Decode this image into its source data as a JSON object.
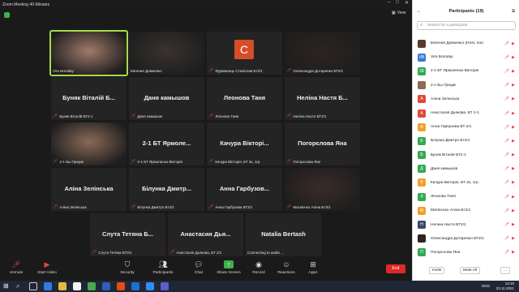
{
  "window": {
    "title": "Zoom Meeting 40-Minutes",
    "view_label": "View"
  },
  "tiles": [
    {
      "name": "",
      "label": "Vira Boroday",
      "muted": false,
      "kind": "photo",
      "photo_color": "#a07a6a",
      "active": true
    },
    {
      "name": "",
      "label": "Евгения Довженко",
      "muted": false,
      "kind": "photo",
      "photo_color": "#3a3230"
    },
    {
      "name": "",
      "label": "Фурманець Станіслав Бт2/1",
      "muted": true,
      "kind": "letter",
      "letter": "C"
    },
    {
      "name": "",
      "label": "Олександра Дотаренко БТ2/1",
      "muted": true,
      "kind": "photo",
      "photo_color": "#2c2420"
    },
    {
      "name": "Буняк Віталій Б...",
      "label": "Буняк Віталій БТ2-1",
      "muted": true,
      "kind": "text"
    },
    {
      "name": "Даня камышов",
      "label": "Даня камышов",
      "muted": true,
      "kind": "text"
    },
    {
      "name": "Леонова Таня",
      "label": "Леонова Таня",
      "muted": true,
      "kind": "text"
    },
    {
      "name": "Неліна Настя Б...",
      "label": "Неліна Настя БТ2/1",
      "muted": true,
      "kind": "text"
    },
    {
      "name": "",
      "label": "2-1 Бы Грицик",
      "muted": true,
      "kind": "photo",
      "photo_color": "#8a6a58"
    },
    {
      "name": "2-1 БТ Ярмоле...",
      "label": "2-1 БТ Ярмоленко Вікторія",
      "muted": true,
      "kind": "text"
    },
    {
      "name": "Качура Вікторі...",
      "label": "Качура Вікторія, БТ 2к, 1гр",
      "muted": true,
      "kind": "text"
    },
    {
      "name": "Погорєлова Яна",
      "label": "Погорєлова Яна",
      "muted": true,
      "kind": "text"
    },
    {
      "name": "Аліна Зелінська",
      "label": "Аліна Зелінська",
      "muted": true,
      "kind": "text"
    },
    {
      "name": "Білунка Дмитр...",
      "label": "Білунка Дмитро Бт2/1",
      "muted": true,
      "kind": "text"
    },
    {
      "name": "Анна Гарбузов...",
      "label": "Анна Гарбузова БТ2/1",
      "muted": true,
      "kind": "text"
    },
    {
      "name": "",
      "label": "Матвієнко Аліна Бт2/1",
      "muted": true,
      "kind": "photo",
      "photo_color": "#3a2c28"
    },
    {
      "name": "Слута Тетяна Б...",
      "label": "Слута Тетяна БТ2/1",
      "muted": true,
      "kind": "text"
    },
    {
      "name": "Анастасия Дья...",
      "label": "Анастасия Дьякова, БТ 2/1",
      "muted": true,
      "kind": "text"
    },
    {
      "name": "Natalia Bertash",
      "label": "Connecting to audio ...",
      "muted": false,
      "kind": "text"
    }
  ],
  "toolbar": {
    "unmute": "Unmute",
    "start_video": "Start Video",
    "security": "Security",
    "participants": "Participants",
    "participants_count": "19",
    "chat": "Chat",
    "share_screen": "Share Screen",
    "record": "Record",
    "reactions": "Reactions",
    "apps": "Apps",
    "end": "End"
  },
  "panel": {
    "title": "Participants (19)",
    "search_placeholder": "Search for a participant",
    "invite": "Invite",
    "mute_all": "Mute All",
    "more": "...",
    "participants": [
      {
        "name": "Евгения Довженко (Host, me)",
        "avatar": "",
        "color": "#5a3a30"
      },
      {
        "name": "Vira Boroday",
        "avatar": "VB",
        "color": "#3a7bd5"
      },
      {
        "name": "2-1 БТ Ярмоленко Вікторія",
        "avatar": "2Б",
        "color": "#34a853"
      },
      {
        "name": "2-1 Бы Грицик",
        "avatar": "",
        "color": "#8a6a58"
      },
      {
        "name": "Аліна Зелінська",
        "avatar": "А",
        "color": "#e0483a"
      },
      {
        "name": "Анастасия Дьякова, БТ 2-1",
        "avatar": "А",
        "color": "#e0483a"
      },
      {
        "name": "Анна Гарбузова БТ 2/1",
        "avatar": "А",
        "color": "#f0a030"
      },
      {
        "name": "Білунка Дмитро Бт2/1",
        "avatar": "Б",
        "color": "#34a853"
      },
      {
        "name": "Буняк Віталій БТ2-1",
        "avatar": "Б",
        "color": "#34a853"
      },
      {
        "name": "Даня камышов",
        "avatar": "Д",
        "color": "#34a853"
      },
      {
        "name": "Качура Вікторія, БТ 2к, 1гр",
        "avatar": "К",
        "color": "#f0a030"
      },
      {
        "name": "Леонова Таня",
        "avatar": "Л",
        "color": "#34a853"
      },
      {
        "name": "Матвієнко Аліна Бт2/1",
        "avatar": "М",
        "color": "#f0a030"
      },
      {
        "name": "Неліна Настя БТ2/1",
        "avatar": "Н",
        "color": "#3a4a6a"
      },
      {
        "name": "Олександра Дотаренко БТ2/1",
        "avatar": "",
        "color": "#2c2420"
      },
      {
        "name": "Погорєлова Яна",
        "avatar": "П",
        "color": "#34a853"
      }
    ]
  },
  "taskbar": {
    "lang": "ENG",
    "time": "13:10",
    "date": "23.11.2021"
  }
}
